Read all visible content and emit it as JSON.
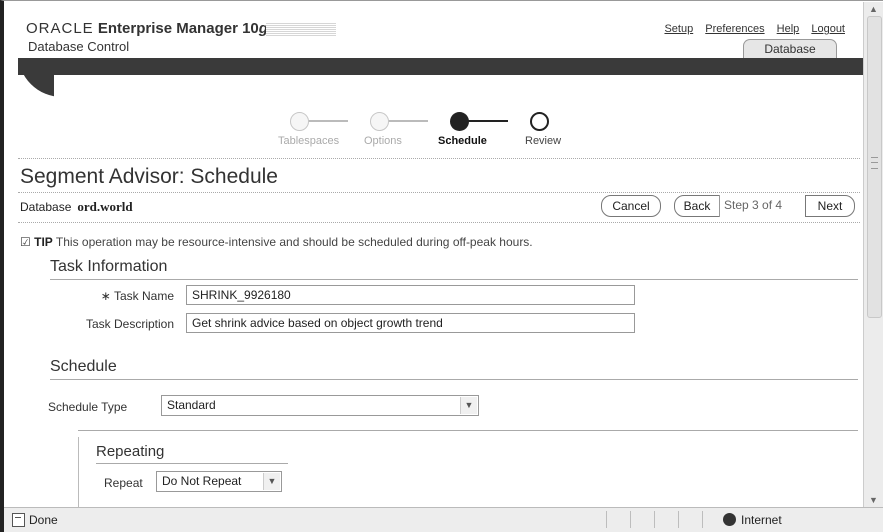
{
  "header": {
    "brand_oracle": "ORACLE",
    "brand_product": "Enterprise Manager 10",
    "brand_version": "g",
    "brand_sub": "Database Control",
    "links": [
      "Setup",
      "Preferences",
      "Help",
      "Logout"
    ],
    "tab": "Database"
  },
  "train": {
    "steps": [
      "Tablespaces",
      "Options",
      "Schedule",
      "Review"
    ],
    "current": 2
  },
  "page": {
    "title": "Segment Advisor: Schedule",
    "database_label": "Database",
    "database_value": "ord.world"
  },
  "buttons": {
    "cancel": "Cancel",
    "back": "Back",
    "step": "Step 3 of 4",
    "next": "Next"
  },
  "tip": {
    "label": "TIP",
    "text": "This operation may be resource-intensive and should be scheduled during off-peak hours."
  },
  "task_info": {
    "heading": "Task Information",
    "name_label": "Task Name",
    "name_value": "SHRINK_9926180",
    "desc_label": "Task Description",
    "desc_value": "Get shrink advice based on object growth trend"
  },
  "schedule": {
    "heading": "Schedule",
    "type_label": "Schedule Type",
    "type_value": "Standard",
    "repeating_heading": "Repeating",
    "repeat_label": "Repeat",
    "repeat_value": "Do Not Repeat"
  },
  "statusbar": {
    "text": "Done",
    "zone": "Internet"
  }
}
